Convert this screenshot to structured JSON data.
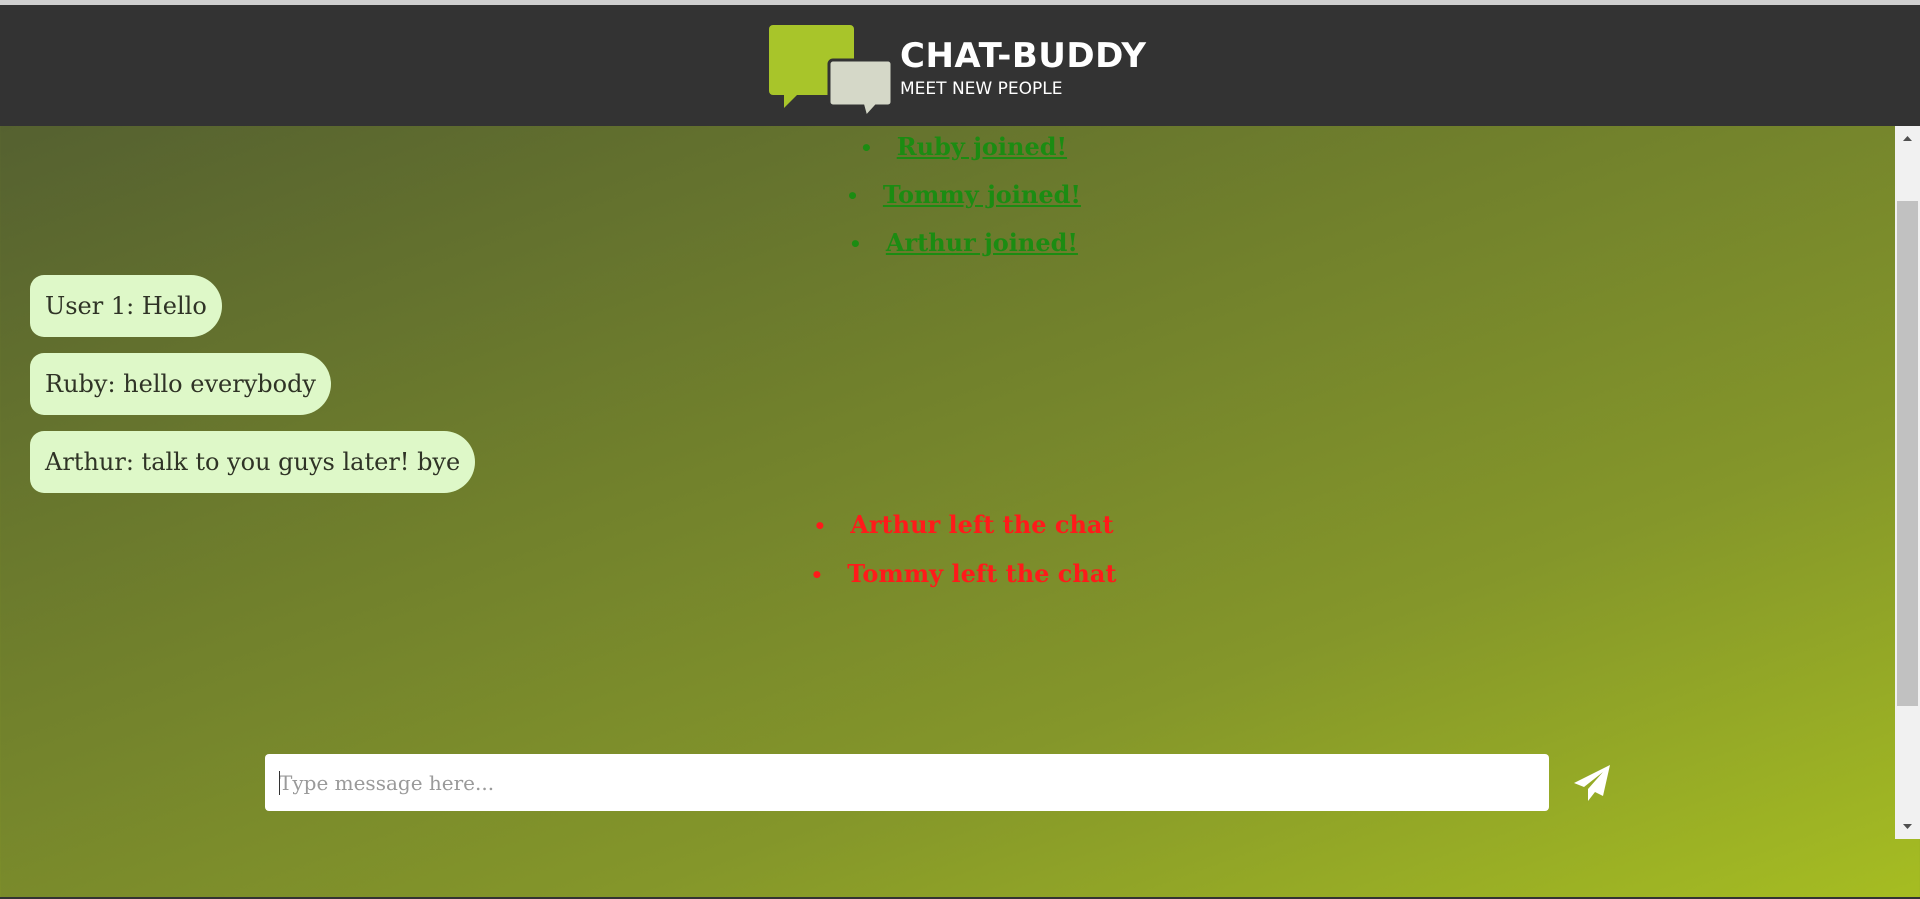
{
  "brand": {
    "title": "CHAT-BUDDY",
    "tagline": "MEET NEW PEOPLE",
    "logo_icon": "chat-bubbles-logo",
    "colors": {
      "bubble_front": "#a8c52a",
      "bubble_back": "#d5d8c8"
    }
  },
  "feed": {
    "joins": [
      {
        "text": "Ruby joined!"
      },
      {
        "text": "Tommy joined!"
      },
      {
        "text": "Arthur joined!"
      }
    ],
    "messages": [
      {
        "text": "User 1: Hello"
      },
      {
        "text": "Ruby: hello everybody"
      },
      {
        "text": "Arthur: talk to you guys later! bye"
      }
    ],
    "leaves": [
      {
        "text": "Arthur left the chat"
      },
      {
        "text": "Tommy left the chat"
      }
    ],
    "bullet": "•",
    "colors": {
      "join": "#1b8c12",
      "leave": "#ff1a1a",
      "bubble": "#def8c8"
    }
  },
  "composer": {
    "placeholder": "Type message here...",
    "value": "",
    "send_icon": "paper-plane-icon"
  },
  "scrollbar": {
    "up_icon": "arrow-up-icon",
    "down_icon": "arrow-down-icon"
  }
}
